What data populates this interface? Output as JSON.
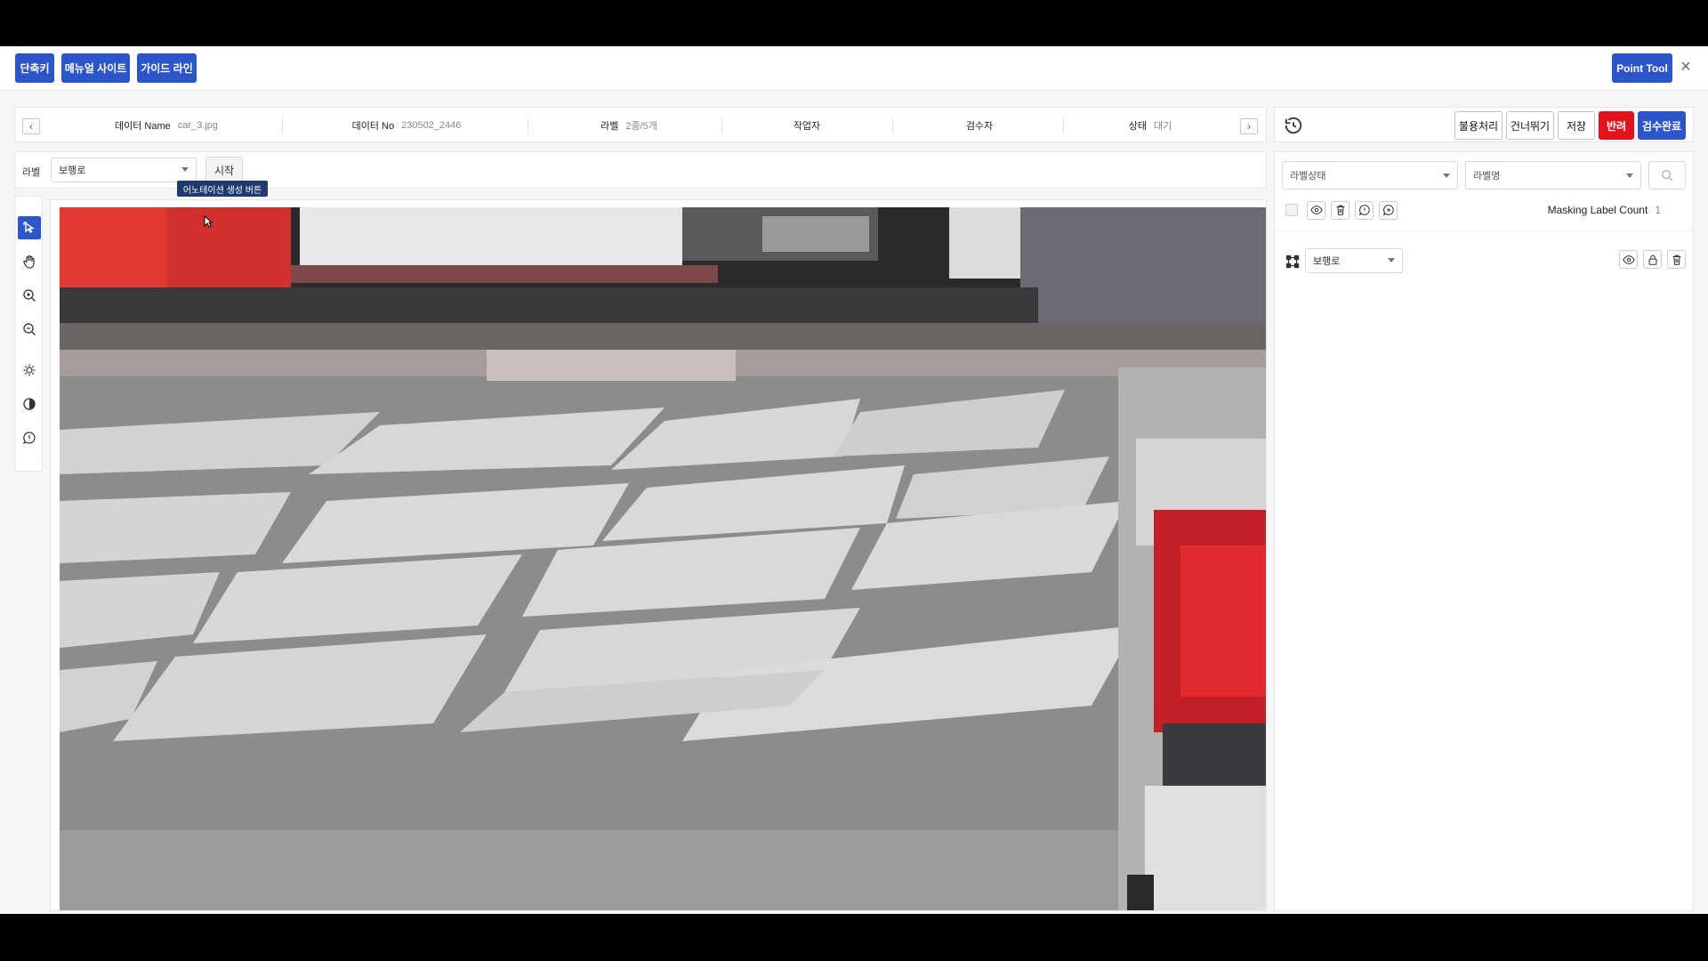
{
  "toolbar": {
    "shortcut_label": "단축키",
    "manual_label": "메뉴얼 사이트",
    "guide_label": "가이드 라인",
    "point_tool_label": "Point Tool",
    "close_symbol": "×"
  },
  "info": {
    "prev_symbol": "‹",
    "next_symbol": "›",
    "data_name_label": "데이터 Name",
    "data_name_value": "car_3.jpg",
    "data_no_label": "데이터 No",
    "data_no_value": "230502_2446",
    "label_label": "라벨",
    "label_value": "2종/5개",
    "worker_label": "작업자",
    "inspector_label": "검수자",
    "status_label": "상태",
    "status_value": "대기"
  },
  "actions": {
    "invalid_label": "불용처리",
    "skip_label": "건너뛰기",
    "save_label": "저장",
    "reject_label": "반려",
    "approve_label": "검수완료"
  },
  "labelbar": {
    "label_text": "라벨",
    "selected_label": "보행로",
    "start_label": "시작",
    "tooltip": "어노테이션 생성 버튼"
  },
  "tools": [
    "select-tool",
    "pan-tool",
    "zoom-in-tool",
    "zoom-out-tool",
    "brightness-tool",
    "contrast-tool",
    "comment-tool"
  ],
  "panel": {
    "status_filter_placeholder": "라벨상태",
    "name_filter_placeholder": "라벨명",
    "mask_count_label": "Masking Label Count",
    "mask_count_value": "1",
    "items": [
      {
        "label": "보행로"
      }
    ]
  },
  "colors": {
    "accent": "#2b55c8",
    "danger": "#e4131b"
  }
}
